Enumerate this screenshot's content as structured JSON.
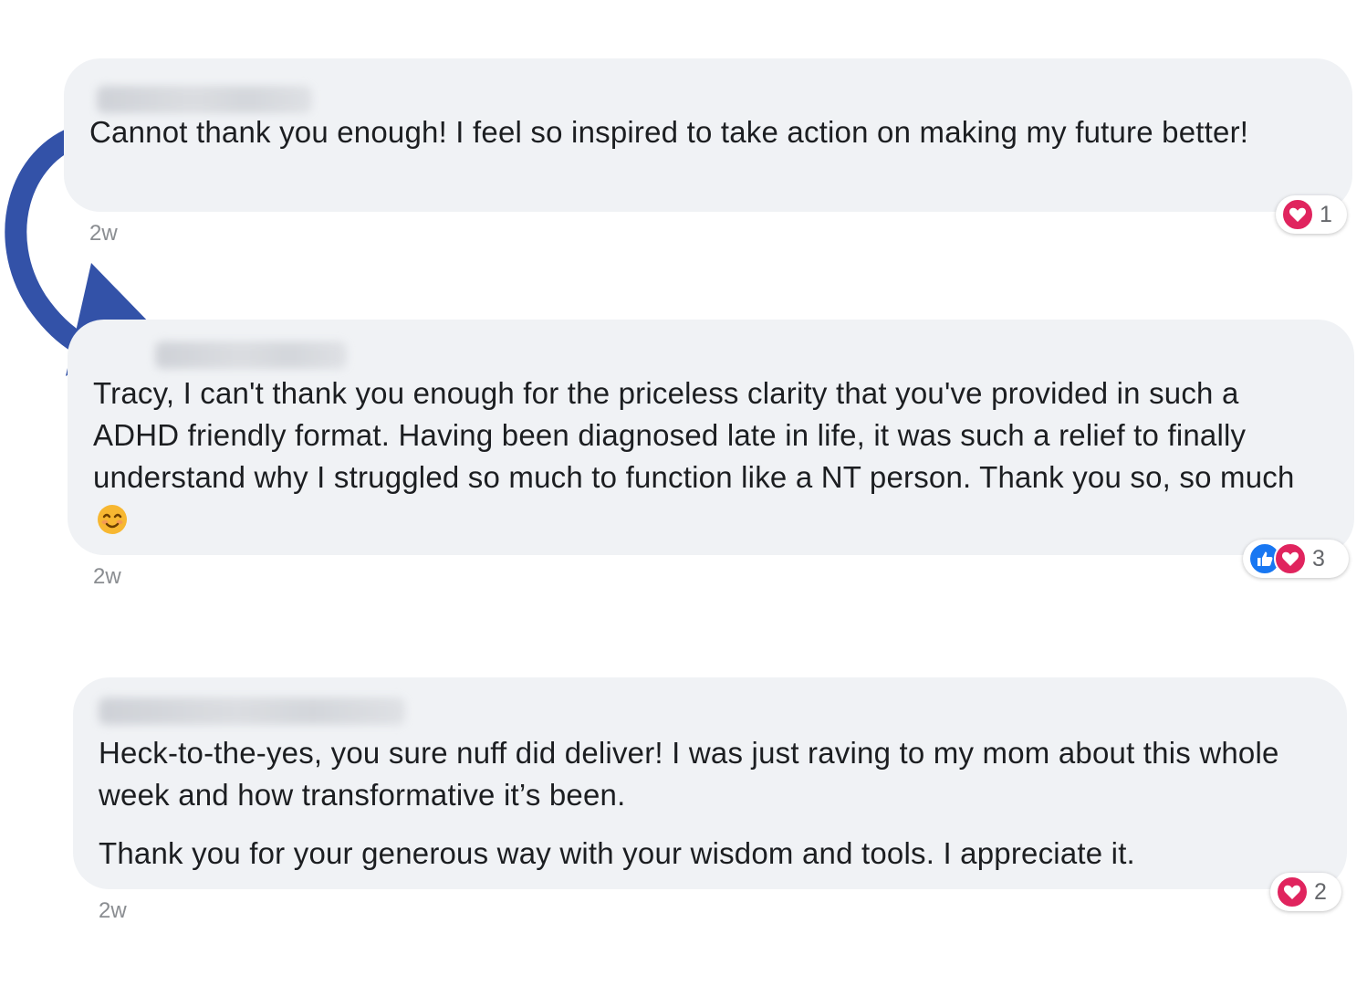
{
  "comments": [
    {
      "text_lines": [
        "Cannot thank you enough! I feel so inspired to take action on making my future better!"
      ],
      "timestamp": "2w",
      "reactions": [
        "heart-icon"
      ],
      "reaction_count": "1"
    },
    {
      "text_lines": [
        "Tracy, I can't thank you enough for the priceless clarity that you've provided in such a ADHD friendly format. Having been diagnosed late in life, it was such a relief to finally understand why I struggled so much to function like a NT person. Thank you so, so much"
      ],
      "emoji": "smiling-face-icon",
      "timestamp": "2w",
      "reactions": [
        "like-icon",
        "heart-icon"
      ],
      "reaction_count": "3"
    },
    {
      "text_lines": [
        "Heck-to-the-yes, you sure nuff did deliver! I was just raving to my mom about this whole week and how transformative it’s been.",
        "Thank you for your generous way with your wisdom and tools. I appreciate it."
      ],
      "timestamp": "2w",
      "reactions": [
        "heart-icon"
      ],
      "reaction_count": "2"
    }
  ],
  "colors": {
    "bubble": "#f0f2f5",
    "arrow": "#3352a8",
    "heart": "#e0245e",
    "like": "#1877f2",
    "timestamp": "#8a8d91"
  }
}
